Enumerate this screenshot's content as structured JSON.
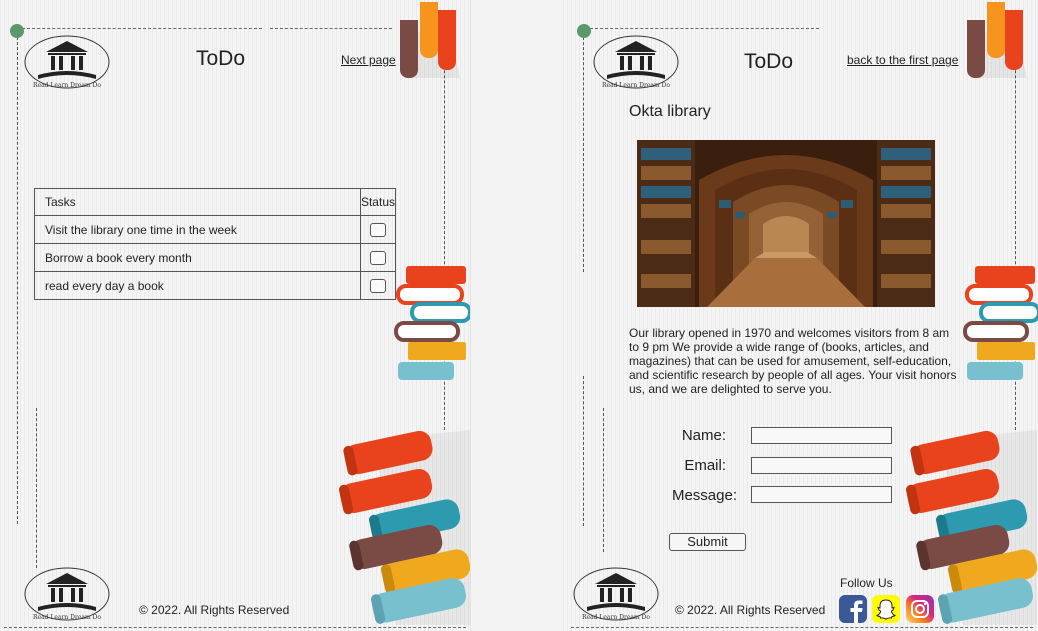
{
  "page_one": {
    "title": "ToDo",
    "next_link": "Next page",
    "table": {
      "headers": [
        "Tasks",
        "Status"
      ],
      "rows": [
        {
          "task": "Visit the library one time in the week",
          "done": false
        },
        {
          "task": "Borrow a book every month",
          "done": false
        },
        {
          "task": "read every day a book",
          "done": false
        }
      ]
    },
    "footer": "© 2022. All Rights Reserved"
  },
  "page_two": {
    "title": "ToDo",
    "back_link": "back to the first page",
    "library_title": "Okta library",
    "description": "Our library opened in 1970 and welcomes visitors from 8 am to 9 pm We provide a wide range of (books, articles, and magazines) that can be used for amusement, self-education, and scientific research by people of all ages. Your visit honors us, and we are delighted to serve you.",
    "form": {
      "name_label": "Name:",
      "email_label": "Email:",
      "message_label": "Message:",
      "name_value": "",
      "email_value": "",
      "message_value": "",
      "submit_label": "Submit"
    },
    "follow_label": "Follow Us",
    "social": [
      "facebook-icon",
      "snapchat-icon",
      "instagram-icon"
    ],
    "footer": "© 2022. All Rights Reserved"
  },
  "logo": {
    "caption": "Read Learn Dream Do"
  },
  "colors": {
    "red": "#e8431c",
    "orange": "#f7941d",
    "teal": "#2e9ab0",
    "brown": "#7a4b45",
    "yellow": "#f0a91e",
    "light_blue": "#79c0cf",
    "dot": "#5a9a6a",
    "facebook": "#3b5998",
    "snapchat": "#fffc00"
  }
}
